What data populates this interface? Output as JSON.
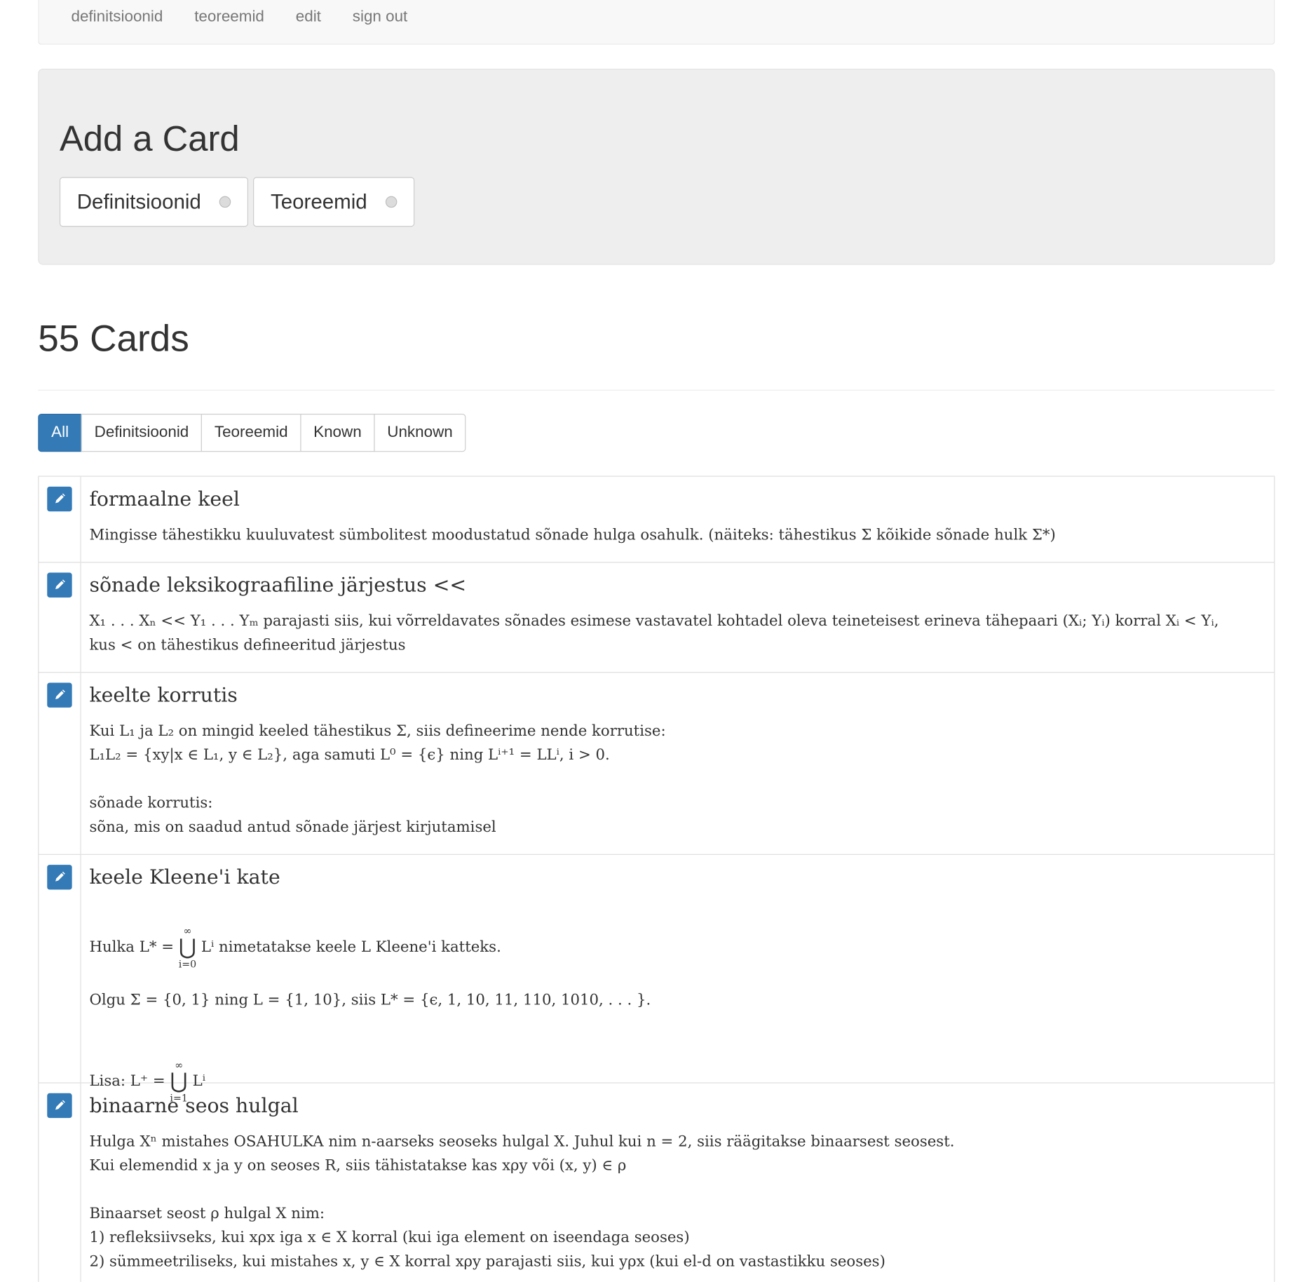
{
  "nav": {
    "links": [
      "definitsioonid",
      "teoreemid",
      "edit",
      "sign out"
    ]
  },
  "add_card": {
    "title": "Add a Card",
    "options": [
      "Definitsioonid",
      "Teoreemid"
    ]
  },
  "cards_header": {
    "title": "55 Cards"
  },
  "filters": {
    "buttons": [
      "All",
      "Definitsioonid",
      "Teoreemid",
      "Known",
      "Unknown"
    ],
    "active": "All",
    "active_color": "#337ab7"
  },
  "icons": {
    "edit": "pencil-icon",
    "radio": "radio-icon"
  },
  "cards": [
    {
      "title": "formaalne keel",
      "text": "Mingisse tähestikku kuuluvatest sümbolitest moodustatud sõnade hulga osahulk. (näiteks: tähestikus Σ kõikide sõnade hulk Σ*)"
    },
    {
      "title": "sõnade leksikograafiline järjestus <<",
      "text": "X₁ . . . Xₙ << Y₁ . . . Yₘ  parajasti siis, kui võrreldavates sõnades esimese vastavatel kohtadel oleva teineteisest erineva tähepaari (Xᵢ; Yᵢ) korral Xᵢ < Yᵢ,\nkus < on tähestikus defineeritud järjestus"
    },
    {
      "title": "keelte korrutis",
      "text": "Kui L₁ ja L₂ on mingid keeled tähestikus Σ, siis defineerime nende korrutise:\nL₁L₂ = {xy|x ∈ L₁, y ∈ L₂}, aga samuti L⁰ = {ϵ} ning Lⁱ⁺¹ = LLⁱ, i > 0.\n\nsõnade korrutis:\nsõna, mis on saadud antud sõnade järjest kirjutamisel"
    },
    {
      "title": "keele Kleene'i kate",
      "text1": "Hulka L* = ",
      "union1": {
        "top": "∞",
        "bottom": "i=0"
      },
      "text1b": " Lⁱ  nimetatakse keele L Kleene'i katteks.",
      "text2": "Olgu Σ = {0, 1} ning L = {1, 10}, siis L* = {ϵ, 1, 10, 11, 110, 1010, . . . }.",
      "text3": "Lisa: L⁺ = ",
      "union2": {
        "top": "∞",
        "bottom": "i=1"
      },
      "text3b": " Lⁱ"
    },
    {
      "title": "binaarne seos hulgal",
      "text": "Hulga Xⁿ mistahes OSAHULKA nim n-aarseks seoseks hulgal X. Juhul kui n = 2, siis räägitakse binaarsest seosest.\nKui elemendid x ja y on seoses R, siis tähistatakse kas xρy või (x, y) ∈ ρ\n\nBinaarset seost ρ hulgal X nim:\n1) refleksiivseks, kui xρx iga x ∈ X korral (kui iga element on iseendaga seoses)\n2) sümmeetriliseks, kui mistahes x, y ∈ X korral xρy parajasti siis, kui yρx (kui el-d on vastastikku seoses)"
    }
  ]
}
